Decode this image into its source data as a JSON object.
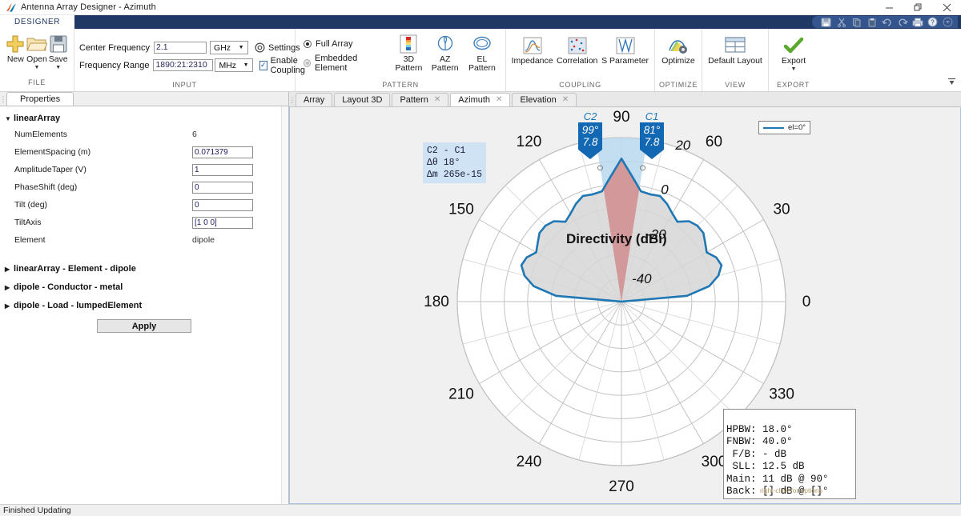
{
  "window": {
    "title": "Antenna Array Designer - Azimuth",
    "minimize": "—",
    "maximize": "❐",
    "close": "✕"
  },
  "ribbon": {
    "tab": "DESIGNER",
    "quick_access": [
      "save-icon",
      "cut-icon",
      "copy-icon",
      "paste-icon",
      "undo-icon",
      "redo-icon",
      "print-icon",
      "help-icon",
      "dropdown-icon"
    ],
    "groups": [
      {
        "label": "FILE",
        "buttons": [
          {
            "label": "New",
            "icon": "new-plus-icon",
            "has_dropdown": false
          },
          {
            "label": "Open",
            "icon": "open-folder-icon",
            "has_dropdown": true
          },
          {
            "label": "Save",
            "icon": "save-floppy-icon",
            "has_dropdown": true
          }
        ]
      },
      {
        "label": "INPUT",
        "fields": [
          {
            "label": "Center Frequency",
            "value": "2.1",
            "unit": "GHz"
          },
          {
            "label": "Frequency Range",
            "value": "1890:21:2310",
            "unit": "MHz"
          }
        ],
        "settings_label": "Settings",
        "coupling_label": "Enable Coupling",
        "coupling_checked": true
      },
      {
        "label": "PATTERN",
        "radios": [
          {
            "label": "Full Array",
            "selected": true
          },
          {
            "label": "Embedded Element",
            "selected": false
          }
        ],
        "buttons": [
          {
            "label": "3D Pattern",
            "icon": "3d-pattern-icon"
          },
          {
            "label": "AZ Pattern",
            "icon": "az-pattern-icon"
          },
          {
            "label": "EL Pattern",
            "icon": "el-pattern-icon"
          }
        ]
      },
      {
        "label": "COUPLING",
        "buttons": [
          {
            "label": "Impedance",
            "icon": "impedance-curve-icon"
          },
          {
            "label": "Correlation",
            "icon": "correlation-scatter-icon"
          },
          {
            "label": "S Parameter",
            "icon": "s-parameter-icon"
          }
        ]
      },
      {
        "label": "OPTIMIZE",
        "buttons": [
          {
            "label": "Optimize",
            "icon": "optimize-icon"
          }
        ]
      },
      {
        "label": "VIEW",
        "buttons": [
          {
            "label": "Default Layout",
            "icon": "layout-grid-icon"
          }
        ]
      },
      {
        "label": "EXPORT",
        "buttons": [
          {
            "label": "Export",
            "icon": "export-check-icon",
            "has_dropdown": true
          }
        ]
      }
    ]
  },
  "properties": {
    "tab_label": "Properties",
    "sections": [
      {
        "title": "linearArray",
        "expanded": true
      },
      {
        "title": "linearArray - Element - dipole",
        "expanded": false
      },
      {
        "title": "dipole - Conductor - metal",
        "expanded": false
      },
      {
        "title": "dipole - Load - lumpedElement",
        "expanded": false
      }
    ],
    "rows": [
      {
        "name": "NumElements",
        "value": "6",
        "editable": false
      },
      {
        "name": "ElementSpacing (m)",
        "value": "0.071379",
        "editable": true
      },
      {
        "name": "AmplitudeTaper (V)",
        "value": "1",
        "editable": true
      },
      {
        "name": "PhaseShift (deg)",
        "value": "0",
        "editable": true
      },
      {
        "name": "Tilt (deg)",
        "value": "0",
        "editable": true
      },
      {
        "name": "TiltAxis",
        "value": "[1 0 0]",
        "editable": true
      },
      {
        "name": "Element",
        "value": "dipole",
        "editable": false
      }
    ],
    "apply_label": "Apply"
  },
  "doc_tabs": [
    {
      "label": "Array",
      "closable": false,
      "active": false
    },
    {
      "label": "Layout 3D",
      "closable": false,
      "active": false
    },
    {
      "label": "Pattern",
      "closable": true,
      "active": false
    },
    {
      "label": "Azimuth",
      "closable": true,
      "active": true
    },
    {
      "label": "Elevation",
      "closable": true,
      "active": false
    }
  ],
  "status": {
    "text": "Finished Updating"
  },
  "plot": {
    "legend": "el=0°",
    "info_box": [
      "C2 - C1",
      "Δθ 18°",
      "Δm 265e-15"
    ],
    "markers": [
      {
        "name": "C2",
        "angle": "99°",
        "value": "7.8"
      },
      {
        "name": "C1",
        "angle": "81°",
        "value": "7.8"
      }
    ],
    "stats": [
      {
        "key": "HPBW:",
        "value": "18.0°"
      },
      {
        "key": "FNBW:",
        "value": "40.0°"
      },
      {
        "key": " F/B:",
        "value": "- dB"
      },
      {
        "key": " SLL:",
        "value": "12.5 dB"
      },
      {
        "key": "Main:",
        "value": "11 dB @ 90°"
      },
      {
        "key": "Back:",
        "value": "[] dB @ []°"
      }
    ],
    "stats_hint": "right-click for options",
    "accent_color": "#1f77b4"
  },
  "chart_data": {
    "type": "line",
    "projection": "polar",
    "title": "Directivity (dBi)",
    "legend": [
      "el=0°"
    ],
    "legend_position": "top-right",
    "grid": true,
    "angle_unit": "deg",
    "angle_ticks": [
      0,
      30,
      60,
      90,
      120,
      150,
      180,
      210,
      240,
      270,
      300,
      330
    ],
    "angle_tick_labels": [
      "0",
      "30",
      "60",
      "90",
      "120",
      "150",
      "180",
      "210",
      "240",
      "270",
      "300",
      "330"
    ],
    "rlim": [
      -50,
      20
    ],
    "r_ticks": [
      -40,
      -20,
      0,
      20
    ],
    "r_tick_labels": [
      "-40",
      "-20",
      "0",
      "20"
    ],
    "rlabel": "Directivity (dBi)",
    "series": [
      {
        "name": "el=0°",
        "color": "#1f77b4",
        "theta": [
          0,
          5,
          10,
          15,
          20,
          25,
          30,
          35,
          40,
          45,
          50,
          55,
          60,
          65,
          70,
          75,
          80,
          85,
          90,
          95,
          100,
          105,
          110,
          115,
          120,
          125,
          130,
          135,
          140,
          145,
          150,
          155,
          160,
          165,
          170,
          175,
          180
        ],
        "r": [
          -50,
          -22,
          -12,
          -7.2,
          -4.6,
          -5.4,
          -8.0,
          -6.4,
          -4.4,
          -4.2,
          -5.2,
          -8.4,
          -6.6,
          -4.0,
          -2.0,
          -2.6,
          -2.2,
          3.5,
          11.0,
          3.5,
          -2.2,
          -2.6,
          -2.0,
          -4.0,
          -6.6,
          -8.4,
          -5.2,
          -4.2,
          -4.4,
          -6.4,
          -8.0,
          -5.4,
          -4.6,
          -7.2,
          -12,
          -22,
          -50
        ]
      }
    ],
    "annotations": {
      "cursors": [
        {
          "name": "C1",
          "theta": 81,
          "r": 7.8
        },
        {
          "name": "C2",
          "theta": 99,
          "r": 7.8
        }
      ],
      "delta_theta": 18,
      "delta_magnitude": "265e-15",
      "hpbw_deg": 18.0,
      "fnbw_deg": 40.0,
      "front_to_back_db": null,
      "sll_db": 12.5,
      "main_lobe_db": 11,
      "main_lobe_angle_deg": 90
    }
  }
}
